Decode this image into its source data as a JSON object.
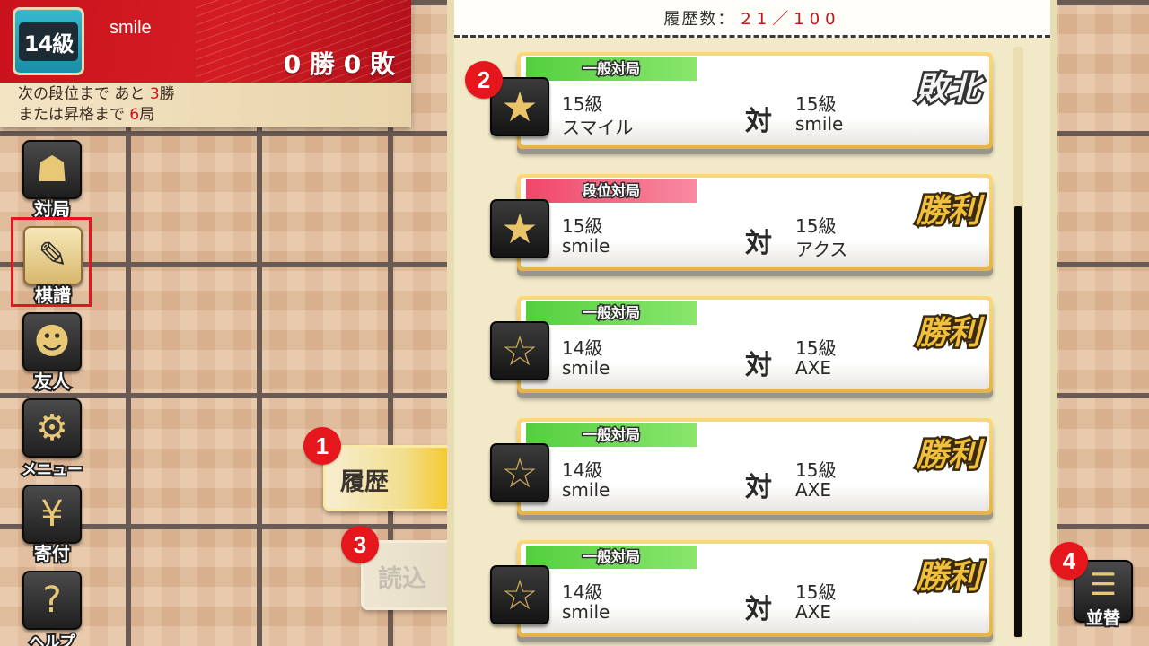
{
  "player": {
    "rank_badge": "14級",
    "name": "smile",
    "record": "0 勝 0 敗",
    "next_line_prefix": "次の段位まで あと",
    "next_wins": "3",
    "next_line_suffix": "勝",
    "promo_line_prefix": "または昇格まで",
    "promo_games": "6",
    "promo_line_suffix": "局"
  },
  "nav": [
    {
      "label": "対局",
      "icon": "shogi-piece-icon"
    },
    {
      "label": "棋譜",
      "icon": "kifu-pen-icon",
      "active": true
    },
    {
      "label": "友人",
      "icon": "friends-icon"
    },
    {
      "label": "メニュー",
      "icon": "menu-gear-icon"
    },
    {
      "label": "寄付",
      "icon": "donation-box-icon"
    },
    {
      "label": "ヘルプ",
      "icon": "help-person-icon"
    }
  ],
  "tabs": {
    "history": "履歴",
    "load": "読込"
  },
  "history": {
    "label": "履歴数：",
    "count": "21／100",
    "vs": "対",
    "rows": [
      {
        "mode": "一般対局",
        "mode_type": "casual",
        "starred": true,
        "my_rank": "15級",
        "my_name": "スマイル",
        "opp_rank": "15級",
        "opp_name": "smile",
        "result": "敗北",
        "result_type": "lose"
      },
      {
        "mode": "段位対局",
        "mode_type": "ranked",
        "starred": true,
        "my_rank": "15級",
        "my_name": "smile",
        "opp_rank": "15級",
        "opp_name": "アクス",
        "result": "勝利",
        "result_type": "win"
      },
      {
        "mode": "一般対局",
        "mode_type": "casual",
        "starred": false,
        "my_rank": "14級",
        "my_name": "smile",
        "opp_rank": "15級",
        "opp_name": "AXE",
        "result": "勝利",
        "result_type": "win"
      },
      {
        "mode": "一般対局",
        "mode_type": "casual",
        "starred": false,
        "my_rank": "14級",
        "my_name": "smile",
        "opp_rank": "15級",
        "opp_name": "AXE",
        "result": "勝利",
        "result_type": "win"
      },
      {
        "mode": "一般対局",
        "mode_type": "casual",
        "starred": false,
        "my_rank": "14級",
        "my_name": "smile",
        "opp_rank": "15級",
        "opp_name": "AXE",
        "result": "勝利",
        "result_type": "win"
      }
    ]
  },
  "sort": {
    "label": "並替",
    "icon": "sort-icon"
  },
  "callouts": [
    "1",
    "2",
    "3",
    "4"
  ],
  "colors": {
    "header_red": "#d41d23",
    "accent_red": "#d0101a",
    "casual_green": "#54cf3f",
    "ranked_pink": "#f0476a",
    "gold": "#e9c46a"
  }
}
